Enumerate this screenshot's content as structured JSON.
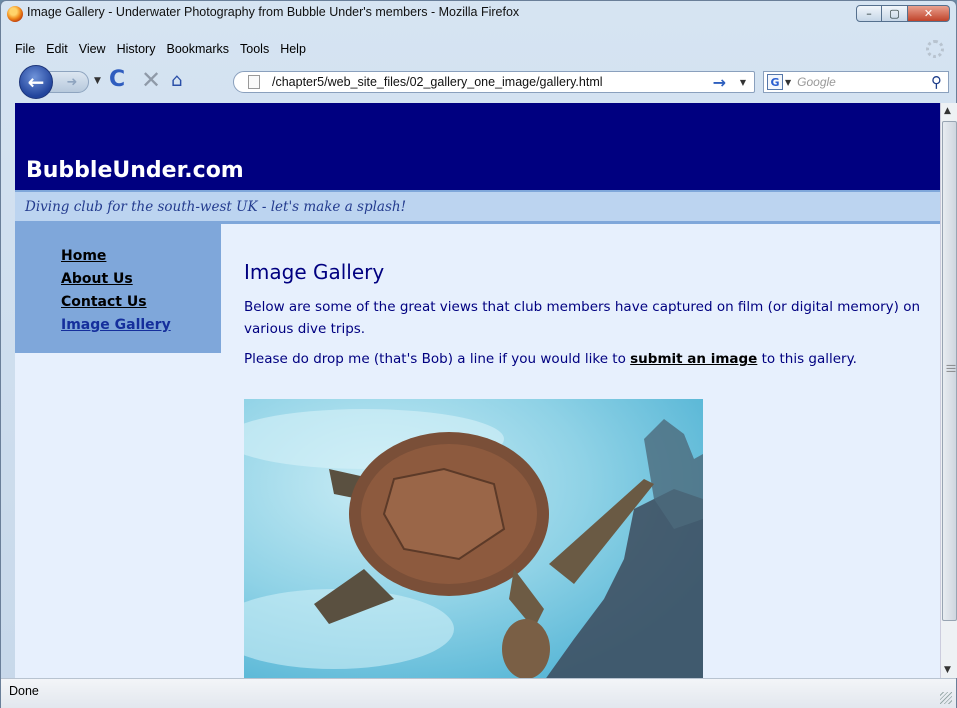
{
  "window": {
    "title": "Image Gallery - Underwater Photography from Bubble Under's members - Mozilla Firefox"
  },
  "menubar": {
    "items": [
      "File",
      "Edit",
      "View",
      "History",
      "Bookmarks",
      "Tools",
      "Help"
    ]
  },
  "navbar": {
    "url": "/chapter5/web_site_files/02_gallery_one_image/gallery.html",
    "search_placeholder": "Google",
    "search_engine_letter": "G"
  },
  "site": {
    "name": "BubbleUnder.com",
    "tagline": "Diving club for the south-west UK - let's make a splash!",
    "nav": [
      {
        "label": "Home"
      },
      {
        "label": "About Us"
      },
      {
        "label": "Contact Us"
      },
      {
        "label": "Image Gallery",
        "current": true
      }
    ]
  },
  "main": {
    "heading": "Image Gallery",
    "intro": "Below are some of the great views that club members have captured on film (or digital memory) on various dive trips.",
    "submit_prefix": "Please do drop me (that's Bob) a line if you would like to ",
    "submit_link": "submit an image",
    "submit_suffix": " to this gallery."
  },
  "statusbar": {
    "text": "Done"
  },
  "colors": {
    "header_bg": "#000080",
    "tagline_bg": "#bcd4f0",
    "nav_bg": "#7fa7da",
    "page_bg": "#e7f0fd",
    "text": "#000080"
  },
  "icons": [
    "firefox-icon",
    "back-icon",
    "forward-icon",
    "reload-icon",
    "stop-icon",
    "home-icon",
    "page-icon",
    "go-arrow-icon",
    "google-icon",
    "magnifier-icon"
  ]
}
